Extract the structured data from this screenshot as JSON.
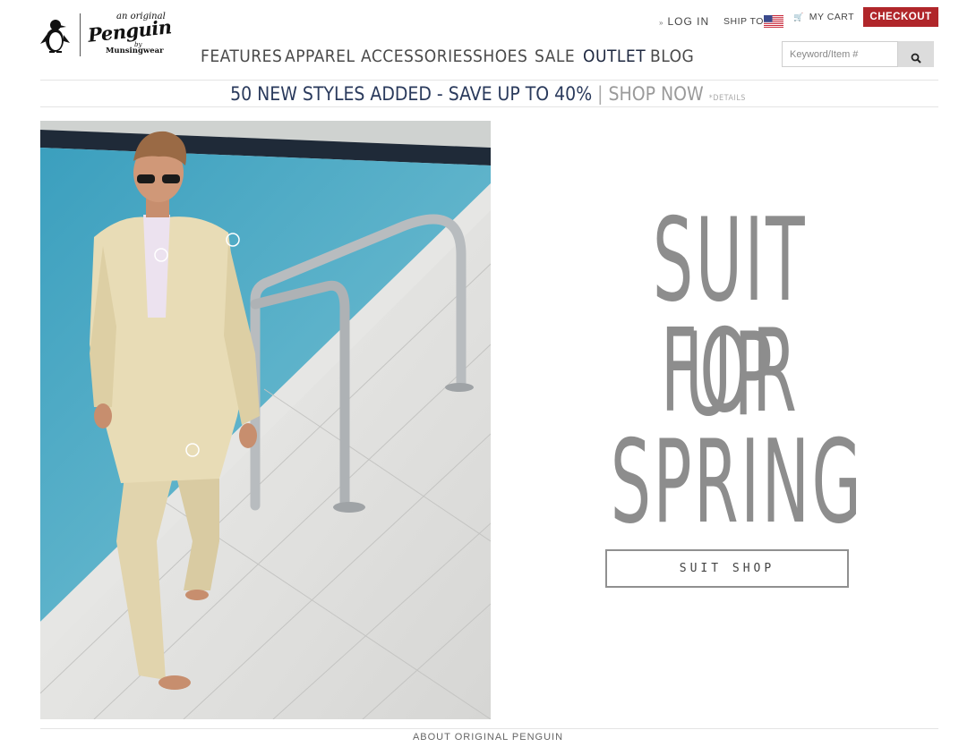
{
  "brand": {
    "tagline": "an original",
    "name": "Penguin",
    "by": "by",
    "maker": "Munsingwear"
  },
  "util": {
    "login": "LOG IN",
    "ship_to": "SHIP TO",
    "cart": "MY CART",
    "checkout": "CHECKOUT"
  },
  "nav": {
    "items": [
      "FEATURES",
      "APPAREL",
      "ACCESSORIES",
      "SHOES",
      "SALE",
      "OUTLET",
      "BLOG"
    ]
  },
  "search": {
    "placeholder": "Keyword/Item #"
  },
  "promo": {
    "main": "50 NEW STYLES ADDED - SAVE UP TO 40%",
    "separator": "|",
    "cta": "SHOP NOW",
    "details": "*DETAILS"
  },
  "hero": {
    "line1": "SUIT UP",
    "line2": "FOR",
    "line3": "SPRING",
    "button": "SUIT SHOP"
  },
  "footer": {
    "about": "ABOUT ORIGINAL PENGUIN"
  },
  "colors": {
    "checkout": "#b0262a",
    "nav_text": "#4a4a4a",
    "promo_navy": "#2a3a5c",
    "headline_gray": "#8d8d8d"
  }
}
